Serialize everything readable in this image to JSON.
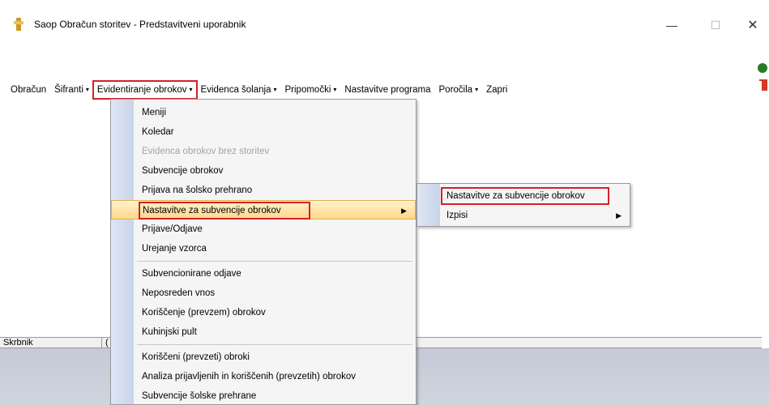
{
  "window": {
    "title": "Saop Obračun storitev - Predstavitveni uporabnik",
    "controls": {
      "minimize": "—",
      "maximize": "☐",
      "close": "✕"
    }
  },
  "menubar": {
    "items": [
      {
        "label": "Obračun",
        "has_arrow": false
      },
      {
        "label": "Šifranti",
        "has_arrow": true
      },
      {
        "label": "Evidentiranje obrokov",
        "has_arrow": true,
        "highlighted": true
      },
      {
        "label": "Evidenca šolanja",
        "has_arrow": true
      },
      {
        "label": "Pripomočki",
        "has_arrow": true
      },
      {
        "label": "Nastavitve programa",
        "has_arrow": false
      },
      {
        "label": "Poročila",
        "has_arrow": true
      },
      {
        "label": "Zapri",
        "has_arrow": false
      }
    ],
    "arrow_glyph": "▾"
  },
  "dropdown": {
    "items": [
      {
        "label": "Meniji"
      },
      {
        "label": "Koledar"
      },
      {
        "label": "Evidenca obrokov brez storitev",
        "disabled": true
      },
      {
        "label": "Subvencije obrokov"
      },
      {
        "label": "Prijava na šolsko prehrano"
      },
      {
        "label": "Nastavitve za subvencije obrokov",
        "active": true,
        "submenu": true
      },
      {
        "label": "Prijave/Odjave"
      },
      {
        "label": "Urejanje vzorca"
      },
      {
        "separator": true
      },
      {
        "label": "Subvencionirane odjave"
      },
      {
        "label": "Neposreden vnos"
      },
      {
        "label": "Koriščenje (prevzem) obrokov"
      },
      {
        "label": "Kuhinjski pult"
      },
      {
        "separator": true
      },
      {
        "label": "Koriščeni (prevzeti) obroki"
      },
      {
        "label": "Analiza prijavljenih in koriščenih (prevzetih) obrokov"
      },
      {
        "label": "Subvencije šolske prehrane"
      }
    ],
    "submenu_arrow": "▶"
  },
  "submenu": {
    "items": [
      {
        "label": "Nastavitve za subvencije obrokov",
        "highlighted": true
      },
      {
        "label": "Izpisi",
        "submenu": true
      }
    ]
  },
  "status": {
    "cell1": "Skrbnik",
    "cell2": "("
  },
  "colors": {
    "highlight_border": "#d4202a",
    "active_item_bg": "#ffd78a",
    "gutter": "#c8d4ea"
  }
}
